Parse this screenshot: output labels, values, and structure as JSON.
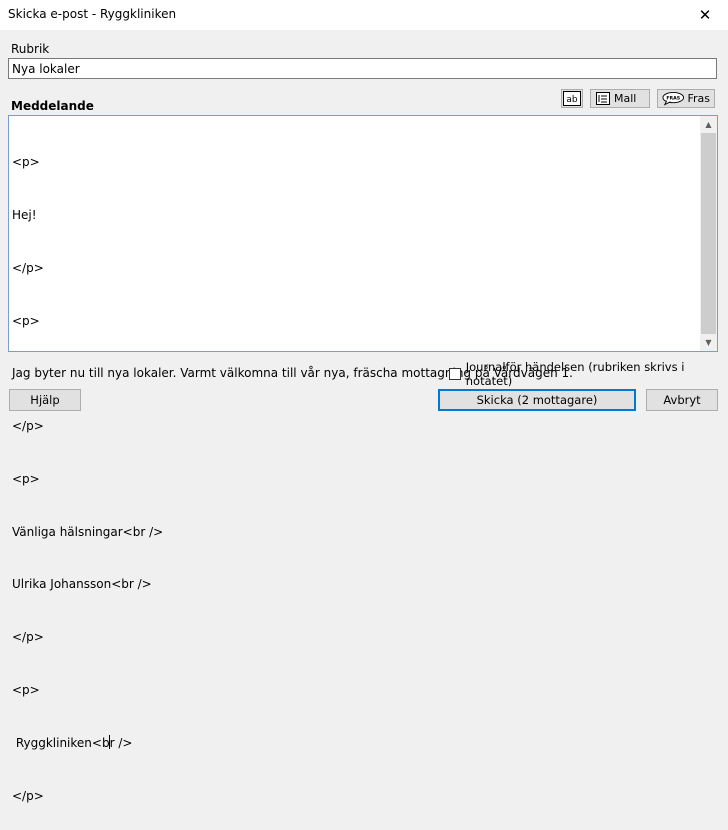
{
  "window": {
    "title": "Skicka e-post - Ryggkliniken",
    "close_glyph": "✕"
  },
  "form": {
    "subject_label": "Rubrik",
    "subject_value": "Nya lokaler",
    "message_label": "Meddelande",
    "message_lines": [
      "<p>",
      "Hej!",
      "</p>",
      "<p>",
      "Jag byter nu till nya lokaler. Varmt välkomna till vår nya, fräscha mottagning på Vårdvägen 1.",
      "</p>",
      "<p>",
      "Vänliga hälsningar<br />",
      "Ulrika Johansson<br />",
      "</p>",
      "<p>",
      " Ryggkliniken<br />",
      "</p>"
    ]
  },
  "toolbar": {
    "ab_label": "ab",
    "template_label": "Mall",
    "phrase_label": "Fras",
    "phrase_icon_text": "FRAS"
  },
  "journal": {
    "checkbox_label": "Journalför händelsen (rubriken skrivs i notatet)",
    "checked": false
  },
  "buttons": {
    "help": "Hjälp",
    "send": "Skicka (2 mottagare)",
    "cancel": "Avbryt"
  }
}
